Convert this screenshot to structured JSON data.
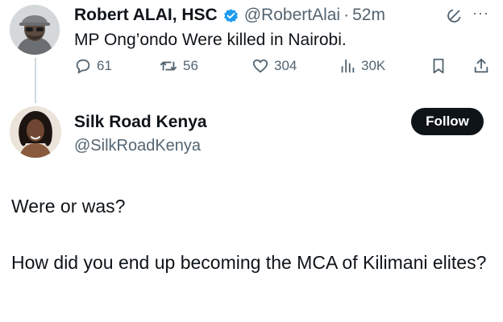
{
  "tweet": {
    "author_name": "Robert ALAI, HSC",
    "handle": "@RobertAlai",
    "separator": "·",
    "time": "52m",
    "more_label": "···",
    "text": "MP Ong’ondo Were killed in Nairobi.",
    "replies": "61",
    "retweets": "56",
    "likes": "304",
    "views": "30K"
  },
  "reply": {
    "author_name": "Silk Road Kenya",
    "handle": "@SilkRoadKenya",
    "follow_label": "Follow",
    "line1": "Were or was?",
    "line2": "How did you end up becoming the MCA of Kilimani elites?"
  },
  "colors": {
    "verified_blue": "#1d9bf0",
    "secondary_text": "#536471",
    "follow_bg": "#0f1419"
  }
}
